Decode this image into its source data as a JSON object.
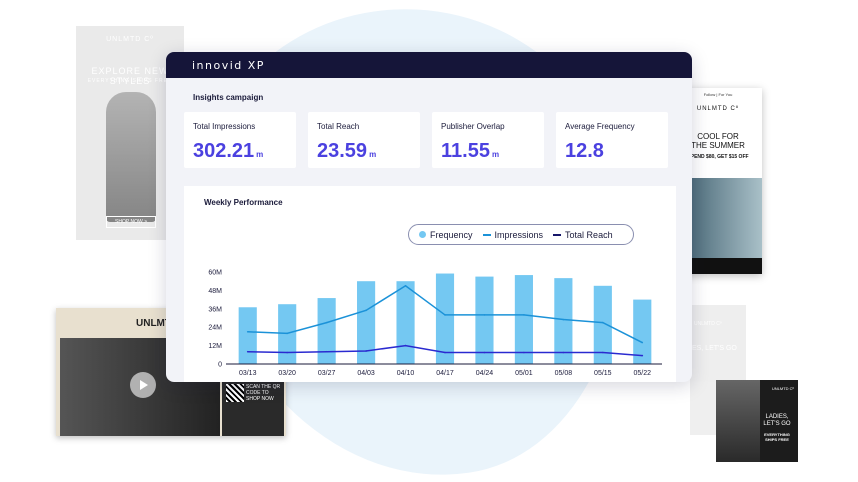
{
  "dashboard": {
    "logo": "innovid XP",
    "campaign_title": "Insights campaign",
    "kpis": [
      {
        "label": "Total Impressions",
        "value": "302.21",
        "unit": "m"
      },
      {
        "label": "Total Reach",
        "value": "23.59",
        "unit": "m"
      },
      {
        "label": "Publisher Overlap",
        "value": "11.55",
        "unit": "m"
      },
      {
        "label": "Average Frequency",
        "value": "12.8",
        "unit": ""
      }
    ],
    "chart_title": "Weekly Performance",
    "legend": [
      "Frequency",
      "Impressions",
      "Total Reach"
    ]
  },
  "colors": {
    "accent": "#4b41e0",
    "header": "#151539",
    "frequency": "#74c8f2",
    "impressions": "#1b92d8",
    "reach": "#2a2ad0"
  },
  "ads": {
    "left_top": {
      "brand": "UNLMTD Cº",
      "headline": "EXPLORE NEW STYLES",
      "sub": "EVERYTHING SHIPS FREE",
      "cta": "SHOP NOW >"
    },
    "left_bottom": {
      "brand": "UNLMTD Cº",
      "qr_text": "SCAN THE QR CODE TO SHOP NOW",
      "play_icon": "play-icon"
    },
    "right_phone": {
      "tabs": "Follow  |  For You",
      "brand": "UNLMTD Cº",
      "headline_1": "COOL FOR",
      "headline_2": "THE SUMMER",
      "promo": "SPEND $80, GET $15 OFF"
    },
    "right_mid": {
      "brand": "UNLMTD Cº",
      "headline": "IES, LET'S GO"
    },
    "right_dark": {
      "brand": "UNLMTD Cº",
      "headline": "LADIES, LET'S GO",
      "sub": "EVERYTHING SHIPS FREE"
    }
  },
  "chart_data": {
    "type": "bar",
    "title": "Weekly Performance",
    "categories": [
      "03/13",
      "03/20",
      "03/27",
      "04/03",
      "04/10",
      "04/17",
      "04/24",
      "05/01",
      "05/08",
      "05/15",
      "05/22"
    ],
    "yticks": [
      "0",
      "12M",
      "24M",
      "36M",
      "48M",
      "60M"
    ],
    "ylim": [
      0,
      60
    ],
    "series": [
      {
        "name": "Frequency",
        "type": "bar",
        "values": [
          37,
          39,
          43,
          54,
          54,
          59,
          57,
          58,
          56,
          51,
          42
        ]
      },
      {
        "name": "Impressions",
        "type": "line",
        "values": [
          21,
          20,
          27,
          35,
          51,
          32,
          32,
          32,
          29,
          27,
          14
        ]
      },
      {
        "name": "Total Reach",
        "type": "line",
        "values": [
          8,
          7.5,
          8,
          8.5,
          12,
          7.5,
          7.5,
          7.5,
          7.5,
          7.5,
          5.5
        ]
      }
    ],
    "grid": false,
    "legend_position": "top-right"
  }
}
